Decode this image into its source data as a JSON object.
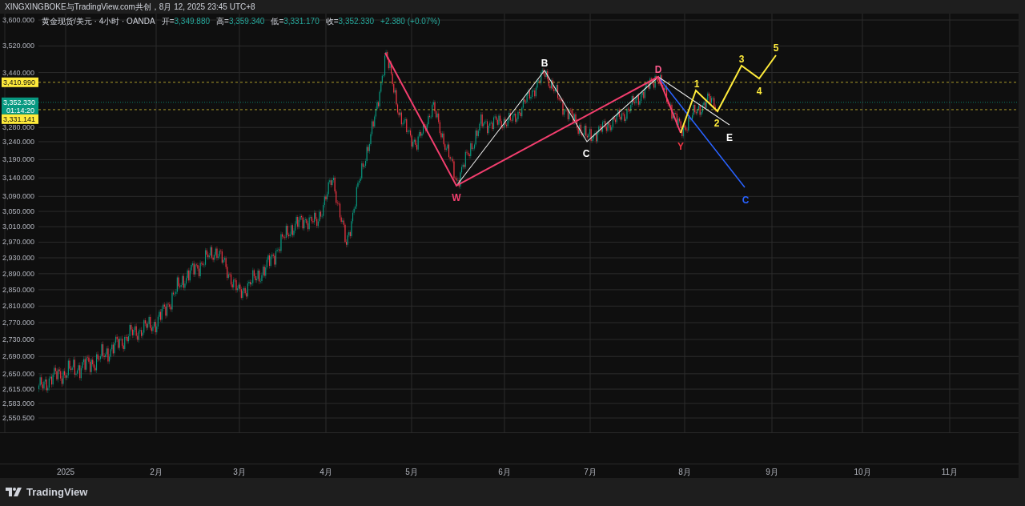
{
  "header": {
    "credit": "XINGXINGBOKE与TradingView.com共创，8月 12, 2025 23:45 UTC+8"
  },
  "legend": {
    "symbol": "黄金现货/美元 · 4小时 · OANDA",
    "ohlc": [
      {
        "label": "开=",
        "value": "3,349.880"
      },
      {
        "label": "高=",
        "value": "3,359.340"
      },
      {
        "label": "低=",
        "value": "3,331.170"
      },
      {
        "label": "收=",
        "value": "3,352.330"
      }
    ],
    "change": "+2.380 (+0.07%)"
  },
  "price_axis": {
    "ticks": [
      "3,600.000",
      "3,520.000",
      "3,440.000",
      "3,280.000",
      "3,240.000",
      "3,190.000",
      "3,140.000",
      "3,090.000",
      "3,050.000",
      "3,010.000",
      "2,970.000",
      "2,930.000",
      "2,890.000",
      "2,850.000",
      "2,810.000",
      "2,770.000",
      "2,730.000",
      "2,690.000",
      "2,650.000",
      "2,615.000",
      "2,583.000",
      "2,550.500"
    ]
  },
  "price_labels": [
    {
      "kind": "level",
      "text": "3,410.990"
    },
    {
      "kind": "last",
      "text": "3,352.330",
      "countdown": "01:14:20"
    },
    {
      "kind": "level",
      "text": "3,331.141"
    }
  ],
  "wave_labels": [
    {
      "text": "W",
      "color": "#f23e6e"
    },
    {
      "text": "B",
      "color": "#ffffff"
    },
    {
      "text": "C",
      "color": "#ffffff"
    },
    {
      "text": "D",
      "color": "#ff5b8e"
    },
    {
      "text": "Y",
      "color": "#f23645"
    },
    {
      "text": "E",
      "color": "#ffffff"
    },
    {
      "text": "C",
      "color": "#2962ff"
    },
    {
      "text": "1",
      "color": "#ffeb3b"
    },
    {
      "text": "2",
      "color": "#ffeb3b"
    },
    {
      "text": "3",
      "color": "#ffeb3b"
    },
    {
      "text": "4",
      "color": "#ffeb3b"
    },
    {
      "text": "5",
      "color": "#ffeb3b"
    }
  ],
  "time_axis": {
    "ticks": [
      "2025",
      "2月",
      "3月",
      "4月",
      "5月",
      "6月",
      "7月",
      "8月",
      "9月",
      "10月",
      "11月"
    ]
  },
  "footer": {
    "logo_text": "TradingView"
  }
}
